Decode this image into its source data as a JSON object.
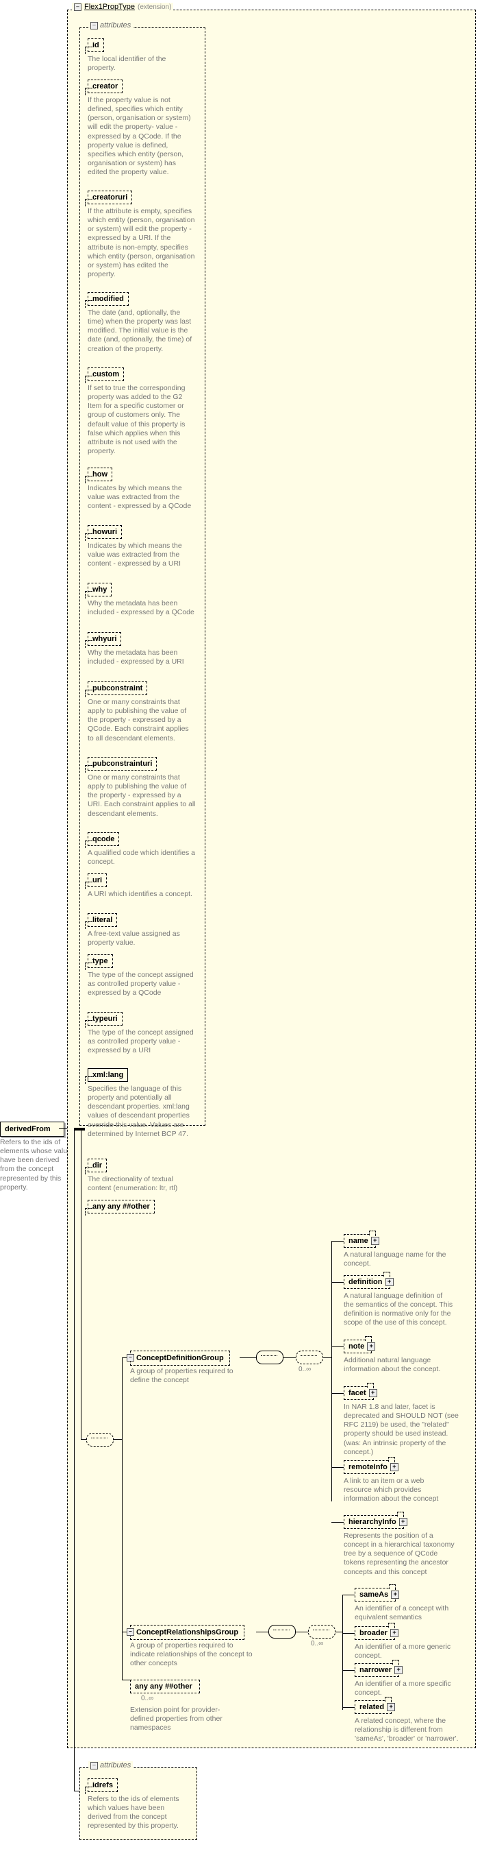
{
  "chart_data": {
    "type": "tree-schema",
    "root": "derivedFrom",
    "extension_of": "Flex1PropType",
    "attribute_groups": [
      {
        "name": "Flex1PropType attributes",
        "attributes": [
          "id",
          "creator",
          "creatoruri",
          "modified",
          "custom",
          "how",
          "howuri",
          "why",
          "whyuri",
          "pubconstraint",
          "pubconstrainturi",
          "qcode",
          "uri",
          "literal",
          "type",
          "typeuri",
          "xml:lang",
          "dir"
        ],
        "wildcard": "any ##other"
      },
      {
        "name": "local attributes",
        "attributes": [
          "idrefs"
        ]
      }
    ],
    "children": [
      {
        "compositor": "sequence",
        "optional": true,
        "children": [
          {
            "group": "ConceptDefinitionGroup",
            "compositor": "sequence_repeat",
            "occurs": "0..∞",
            "children": [
              "name",
              "definition",
              "note",
              "facet",
              "remoteInfo",
              "hierarchyInfo"
            ]
          },
          {
            "group": "ConceptRelationshipsGroup",
            "compositor": "sequence_repeat",
            "occurs": "0..∞",
            "children": [
              "sameAs",
              "broader",
              "narrower",
              "related"
            ]
          },
          {
            "wildcard": "any ##other",
            "occurs": "0..∞"
          }
        ]
      }
    ]
  },
  "root": {
    "label": "derivedFrom",
    "doc": "Refers to the ids of elements whose values have been derived from the concept represented by this property."
  },
  "extension": {
    "name": "Flex1PropType",
    "type": "(extension)"
  },
  "attributes_title": "attributes",
  "attrs": [
    {
      "name": "id",
      "doc": "The local identifier of the property."
    },
    {
      "name": "creator",
      "doc": "If the property value is not defined, specifies which entity (person, organisation or system) will edit the property- value - expressed by a QCode. If the property value is defined, specifies which entity (person, organisation or system) has edited the property value."
    },
    {
      "name": "creatoruri",
      "doc": "If the attribute is empty, specifies which entity (person, organisation or system) will edit the property - expressed by a URI. If the attribute is non-empty, specifies which entity (person, organisation or system) has edited the property."
    },
    {
      "name": "modified",
      "doc": "The date (and, optionally, the time) when the property was last modified. The initial value is the date (and, optionally, the time) of creation of the property."
    },
    {
      "name": "custom",
      "doc": "If set to true the corresponding property was added to the G2 Item for a specific customer or group of customers only. The default value of this property is false which applies when this attribute is not used with the property."
    },
    {
      "name": "how",
      "doc": "Indicates by which means the value was extracted from the content - expressed by a QCode"
    },
    {
      "name": "howuri",
      "doc": "Indicates by which means the value was extracted from the content - expressed by a URI"
    },
    {
      "name": "why",
      "doc": "Why the metadata has been included - expressed by a QCode"
    },
    {
      "name": "whyuri",
      "doc": "Why the metadata has been included - expressed by a URI"
    },
    {
      "name": "pubconstraint",
      "doc": "One or many constraints that apply to publishing the value of the property - expressed by a QCode. Each constraint applies to all descendant elements."
    },
    {
      "name": "pubconstrainturi",
      "doc": "One or many constraints that apply to publishing the value of the property - expressed by a URI. Each constraint applies to all descendant elements."
    },
    {
      "name": "qcode",
      "doc": "A qualified code which identifies a concept."
    },
    {
      "name": "uri",
      "doc": "A URI which identifies a concept."
    },
    {
      "name": "literal",
      "doc": "A free-text value assigned as property value."
    },
    {
      "name": "type",
      "doc": "The type of the concept assigned as controlled property value - expressed by a QCode"
    },
    {
      "name": "typeuri",
      "doc": "The type of the concept assigned as controlled property value - expressed by a URI"
    },
    {
      "name": "xml:lang",
      "doc": "Specifies the language of this property and potentially all descendant properties. xml:lang values of descendant properties override this value. Values are determined by Internet BCP 47."
    },
    {
      "name": "dir",
      "doc": "The directionality of textual content (enumeration: ltr, rtl)"
    }
  ],
  "attr_wildcard": "any ##other",
  "groups": {
    "cdg": {
      "label": "ConceptDefinitionGroup",
      "doc": "A group of properties required to define the concept",
      "occ": "0..∞",
      "items": [
        {
          "name": "name",
          "doc": "A natural language name for the concept."
        },
        {
          "name": "definition",
          "doc": "A natural language definition of the semantics of the concept. This definition is normative only for the scope of the use of this concept."
        },
        {
          "name": "note",
          "doc": "Additional natural language information about the concept."
        },
        {
          "name": "facet",
          "doc": "In NAR 1.8 and later, facet is deprecated and SHOULD NOT (see RFC 2119) be used, the \"related\" property should be used instead.(was: An intrinsic property of the concept.)"
        },
        {
          "name": "remoteInfo",
          "doc": "A link to an item or a web resource which provides information about the concept"
        },
        {
          "name": "hierarchyInfo",
          "doc": "Represents the position of a concept in a hierarchical taxonomy tree by a sequence of QCode tokens representing the ancestor concepts and this concept"
        }
      ]
    },
    "crg": {
      "label": "ConceptRelationshipsGroup",
      "doc": "A group of properties required to indicate relationships of the concept to other concepts",
      "occ": "0..∞",
      "items": [
        {
          "name": "sameAs",
          "doc": "An identifier of a concept with equivalent semantics"
        },
        {
          "name": "broader",
          "doc": "An identifier of a more generic concept."
        },
        {
          "name": "narrower",
          "doc": "An identifier of a more specific concept."
        },
        {
          "name": "related",
          "doc": "A related concept, where the relationship is different from 'sameAs', 'broader' or 'narrower'."
        }
      ]
    }
  },
  "any_other": {
    "label": "any ##other",
    "occ": "0..∞",
    "doc": "Extension point for provider-defined properties from other namespaces"
  },
  "attrs2_title": "attributes",
  "idrefs": {
    "name": "idrefs",
    "doc": "Refers to the ids of elements which values have been derived from the concept represented by this property."
  }
}
